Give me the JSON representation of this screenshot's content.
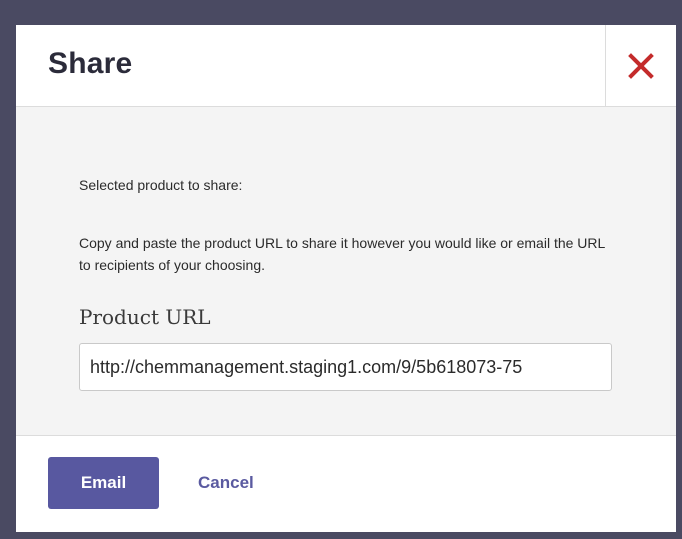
{
  "header": {
    "title": "Share",
    "close_icon": "close-icon",
    "close_color": "#c42b2b"
  },
  "body": {
    "selected_label": "Selected product to share:",
    "description": "Copy and paste the product URL to share it however you would like or email the URL to recipients of your choosing.",
    "url_label": "Product URL",
    "url_value": "http://chemmanagement.staging1.com/9/5b618073-75"
  },
  "footer": {
    "email_label": "Email",
    "cancel_label": "Cancel",
    "accent_color": "#5858a0"
  }
}
